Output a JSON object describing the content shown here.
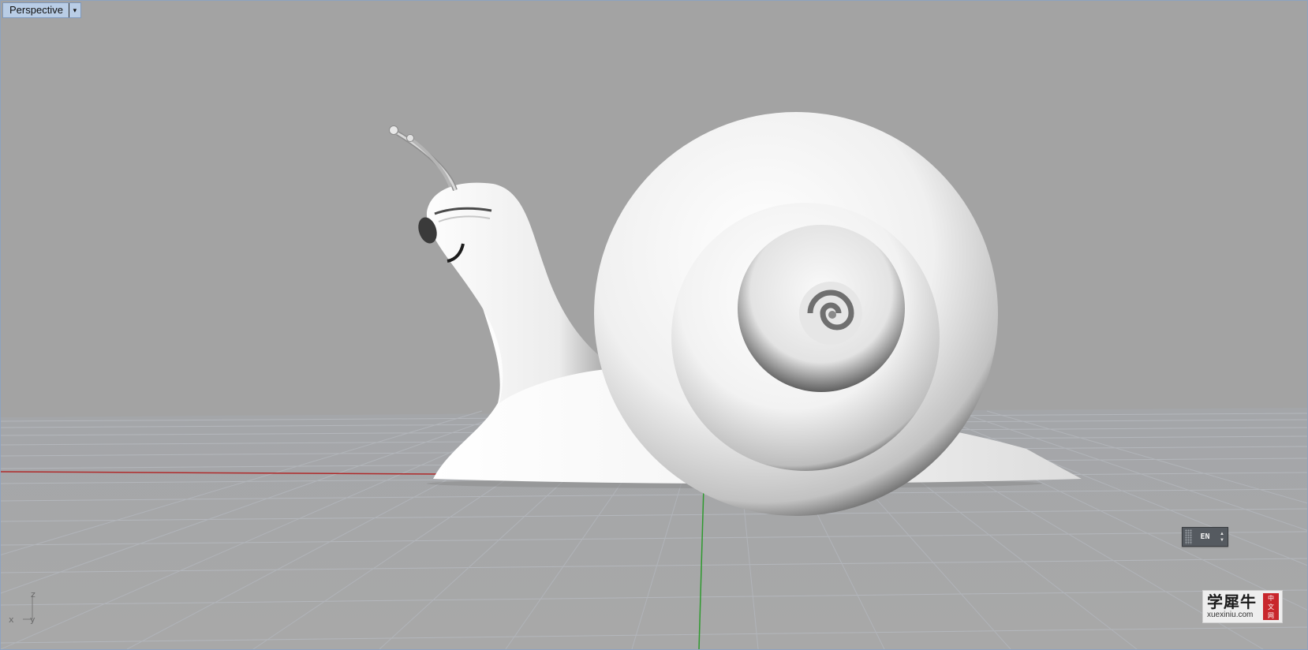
{
  "viewport": {
    "title": "Perspective",
    "menu_arrow": "▾"
  },
  "axes": {
    "z": "z",
    "x": "x",
    "y": "y",
    "x_axis_color": "#b02a2a",
    "y_axis_color": "#2f9a2f"
  },
  "ime": {
    "language": "EN",
    "up": "▲",
    "down": "▼"
  },
  "watermark": {
    "brand": "学犀牛",
    "url": "xuexiniu.com",
    "stamp": [
      "中",
      "文",
      "网"
    ]
  },
  "colors": {
    "background": "#a3a3a3",
    "grid": "#a9adb3",
    "tab_bg": "#b9cde6"
  }
}
